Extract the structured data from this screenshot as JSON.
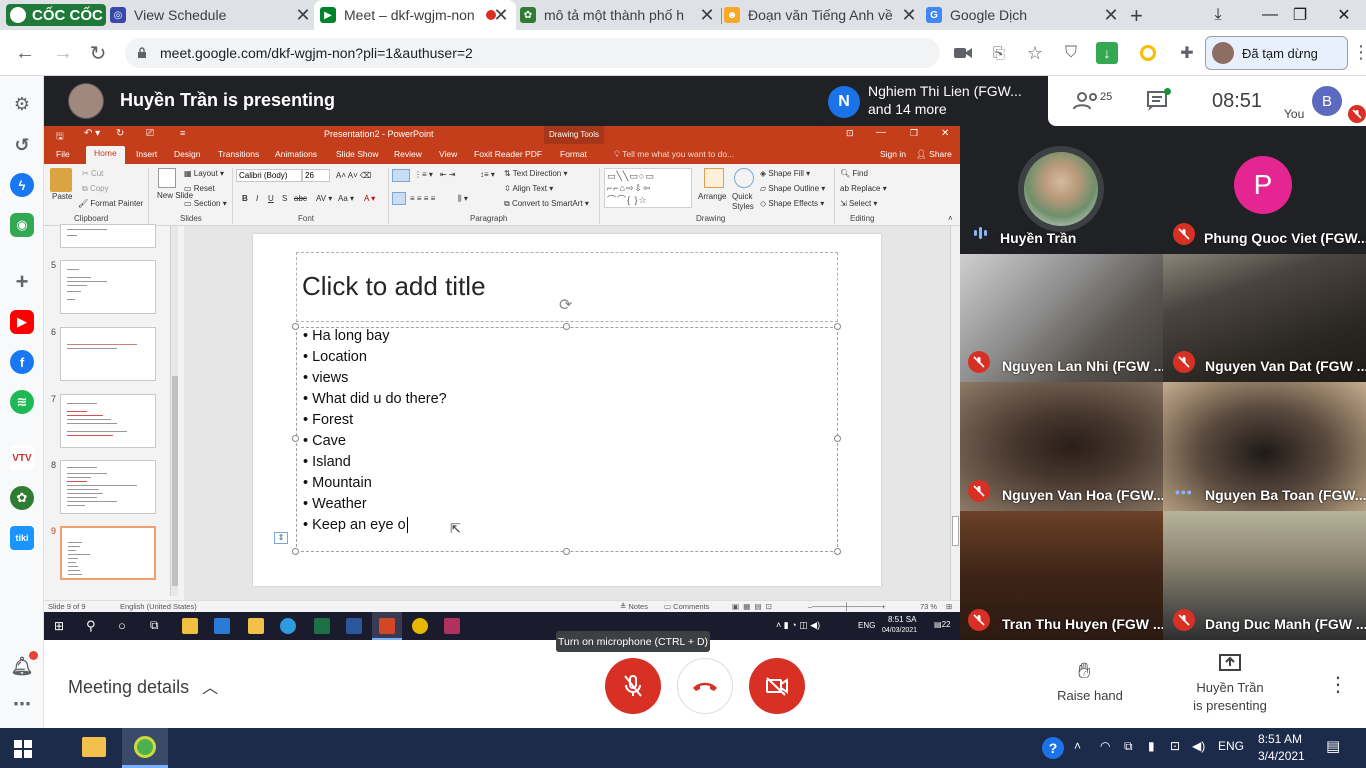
{
  "browser": {
    "tabs": [
      {
        "title": "View Schedule",
        "active": false
      },
      {
        "title": "Meet – dkf-wgjm-non",
        "active": true
      },
      {
        "title": "mô tả một thành phố h",
        "active": false
      },
      {
        "title": "Đoạn văn Tiếng Anh về",
        "active": false
      },
      {
        "title": "Google Dịch",
        "active": false
      }
    ],
    "brand": "CỐC CỐC",
    "url": "meet.google.com/dkf-wgjm-non?pli=1&authuser=2",
    "profile_label": "Đã tạm dừng"
  },
  "meet": {
    "presenting_title": "Huyền Trần is presenting",
    "notice_line1": "Nghiem Thi Lien (FGW...",
    "notice_line2": "and 14 more",
    "notice_initial": "N",
    "participant_count": "25",
    "clock": "08:51",
    "you_label": "You",
    "you_initial": "B",
    "tooltip": "Turn on microphone (CTRL + D)",
    "meeting_details": "Meeting details",
    "raise_hand": "Raise hand",
    "presenting_l1": "Huyền Trần",
    "presenting_l2": "is presenting",
    "tiles": [
      {
        "name": "Huyền Trần"
      },
      {
        "name": "Phung Quoc Viet (FGW..."
      },
      {
        "name": "Nguyen Lan Nhi (FGW ..."
      },
      {
        "name": "Nguyen Van Dat (FGW ..."
      },
      {
        "name": "Nguyen Van Hoa (FGW..."
      },
      {
        "name": "Nguyen Ba Toan (FGW..."
      },
      {
        "name": "Tran Thu Huyen (FGW ..."
      },
      {
        "name": "Dang Duc Manh (FGW ..."
      }
    ],
    "tile_initial_p": "P"
  },
  "ppt": {
    "window_title": "Presentation2 - PowerPoint",
    "drawing_tools": "Drawing Tools",
    "menu": [
      "File",
      "Home",
      "Insert",
      "Design",
      "Transitions",
      "Animations",
      "Slide Show",
      "Review",
      "View",
      "Foxit Reader PDF",
      "Format"
    ],
    "tell_me": "Tell me what you want to do...",
    "sign_in": "Sign in",
    "share": "Share",
    "ribbon": {
      "paste": "Paste",
      "cut": "Cut",
      "copy": "Copy",
      "format_painter": "Format Painter",
      "new_slide": "New Slide",
      "layout": "Layout",
      "reset": "Reset",
      "section": "Section",
      "font": "Calibri (Body)",
      "size": "26",
      "text_direction": "Text Direction",
      "align_text": "Align Text",
      "convert": "Convert to SmartArt",
      "arrange": "Arrange",
      "quick_styles": "Quick Styles",
      "shape_fill": "Shape Fill",
      "shape_outline": "Shape Outline",
      "shape_effects": "Shape Effects",
      "find": "Find",
      "replace": "Replace",
      "select": "Select",
      "groups": [
        "Clipboard",
        "Slides",
        "Font",
        "Paragraph",
        "Drawing",
        "Editing"
      ]
    },
    "thumb_numbers": [
      "5",
      "6",
      "7",
      "8",
      "9"
    ],
    "slide_title": "Click to add title",
    "bullets": [
      "Ha long bay",
      "Location",
      "views",
      "What did u do there?",
      "Forest",
      "Cave",
      "Island",
      "Mountain",
      "Weather",
      "Keep an eye o"
    ],
    "status": {
      "slide": "Slide 9 of 9",
      "lang": "English (United States)",
      "notes": "Notes",
      "comments": "Comments",
      "zoom": "73 %"
    },
    "taskbar_time": "8:51 SA",
    "taskbar_date": "04/03/2021",
    "taskbar_lang": "ENG",
    "taskbar_notif": "22"
  },
  "windows": {
    "time": "8:51 AM",
    "date": "3/4/2021",
    "lang": "ENG"
  },
  "colors": {
    "ppt_red": "#c43e1c",
    "meet_red": "#d93025",
    "meet_dark": "#202124"
  }
}
